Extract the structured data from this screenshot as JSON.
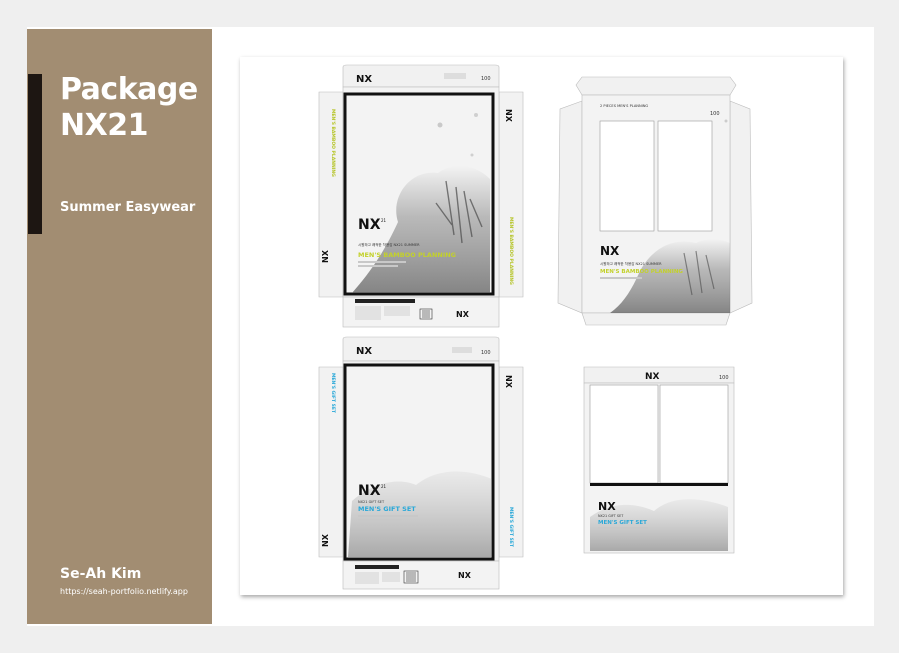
{
  "sidebar": {
    "title_line1": "Package",
    "title_line2": "NX21",
    "subtitle": "Summer Easywear",
    "author": "Se-Ah Kim",
    "url": "https://seah-portfolio.netlify.app"
  },
  "dielines": {
    "bamboo": {
      "brand": "NX",
      "brand_suffix": "21",
      "kicker": "시원하고 쾌적한 착용감 NX21 SUMMER",
      "product": "MEN'S BAMBOO PLANNING",
      "spine": "MEN'S BAMBOO PLANNING",
      "count": "100"
    },
    "gift": {
      "brand": "NX",
      "brand_suffix": "21",
      "kicker": "NX21 GIFT SET",
      "product": "MEN'S GIFT SET",
      "spine": "MEN'S GIFT SET",
      "count": "100"
    },
    "sleeve_label": "2 PIECES MEN'S PLANNING"
  },
  "colors": {
    "sidebar": "#a28d72",
    "accent_bar": "#1d1612",
    "bamboo_accent": "#c3d12b",
    "gift_accent": "#29a8d8"
  }
}
